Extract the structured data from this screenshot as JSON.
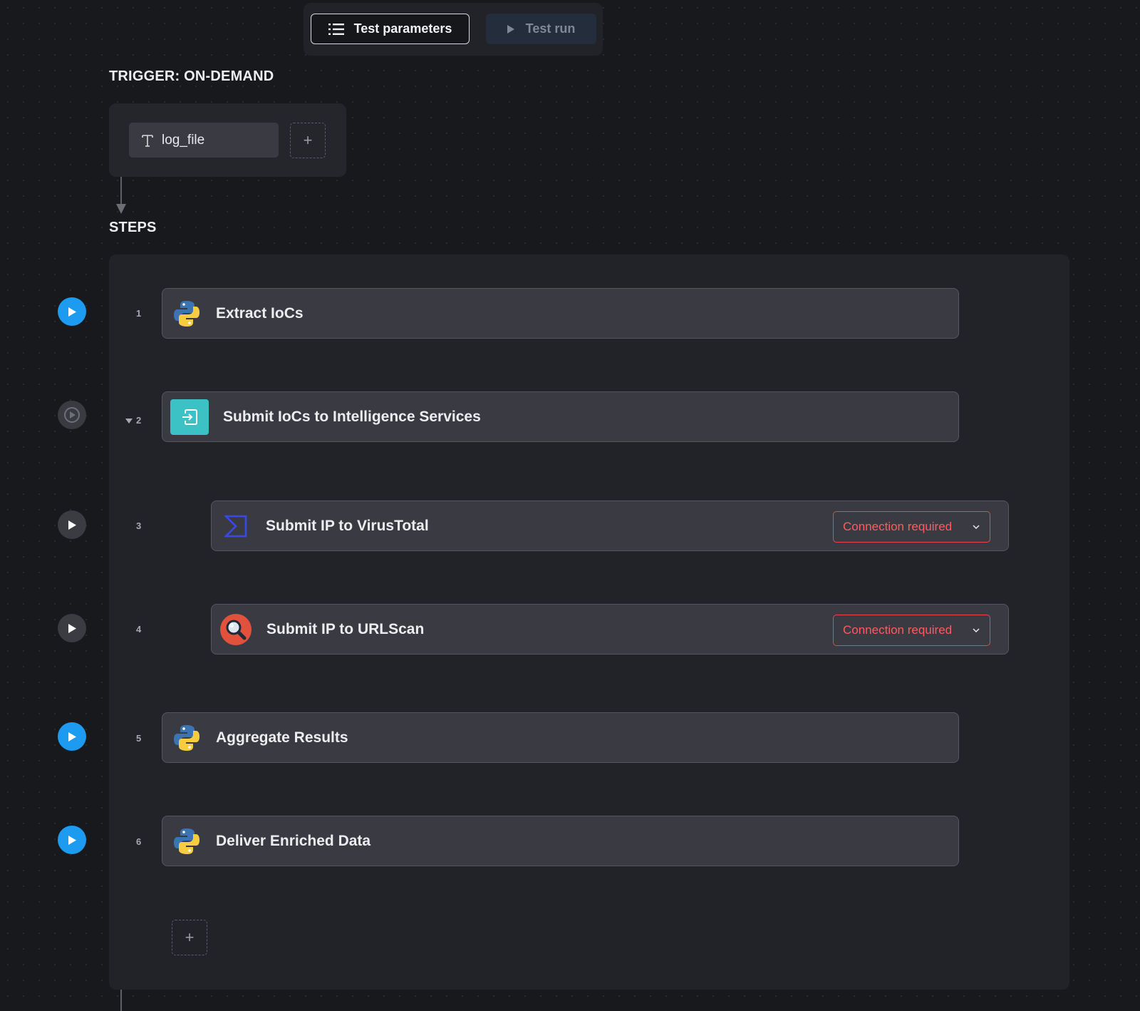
{
  "toolbar": {
    "test_parameters_label": "Test parameters",
    "test_run_label": "Test run"
  },
  "trigger": {
    "heading": "TRIGGER: ON-DEMAND",
    "parameters": [
      {
        "name": "log_file",
        "type_icon": "text-type-icon"
      }
    ],
    "add_label": "+"
  },
  "steps": {
    "heading": "STEPS",
    "items": [
      {
        "number": "1",
        "title": "Extract IoCs",
        "icon": "python-icon",
        "run_state": "ready"
      },
      {
        "number": "2",
        "title": "Submit IoCs to Intelligence Services",
        "icon": "parallel-group-icon",
        "run_state": "group",
        "collapse_icon": "caret-down-icon"
      },
      {
        "number": "3",
        "title": "Submit IP to VirusTotal",
        "icon": "virustotal-icon",
        "run_state": "pending",
        "connection": "Connection required"
      },
      {
        "number": "4",
        "title": "Submit IP to URLScan",
        "icon": "urlscan-icon",
        "run_state": "pending",
        "connection": "Connection required"
      },
      {
        "number": "5",
        "title": "Aggregate Results",
        "icon": "python-icon",
        "run_state": "ready"
      },
      {
        "number": "6",
        "title": "Deliver Enriched Data",
        "icon": "python-icon",
        "run_state": "ready"
      }
    ],
    "add_label": "+"
  },
  "colors": {
    "background": "#18191d",
    "run_button_blue": "#1d9bf0",
    "connection_required": "#ff5a5f",
    "group_icon_teal": "#3cc1c4",
    "virustotal_blue": "#3a48e6",
    "urlscan_red": "#e2513c"
  }
}
